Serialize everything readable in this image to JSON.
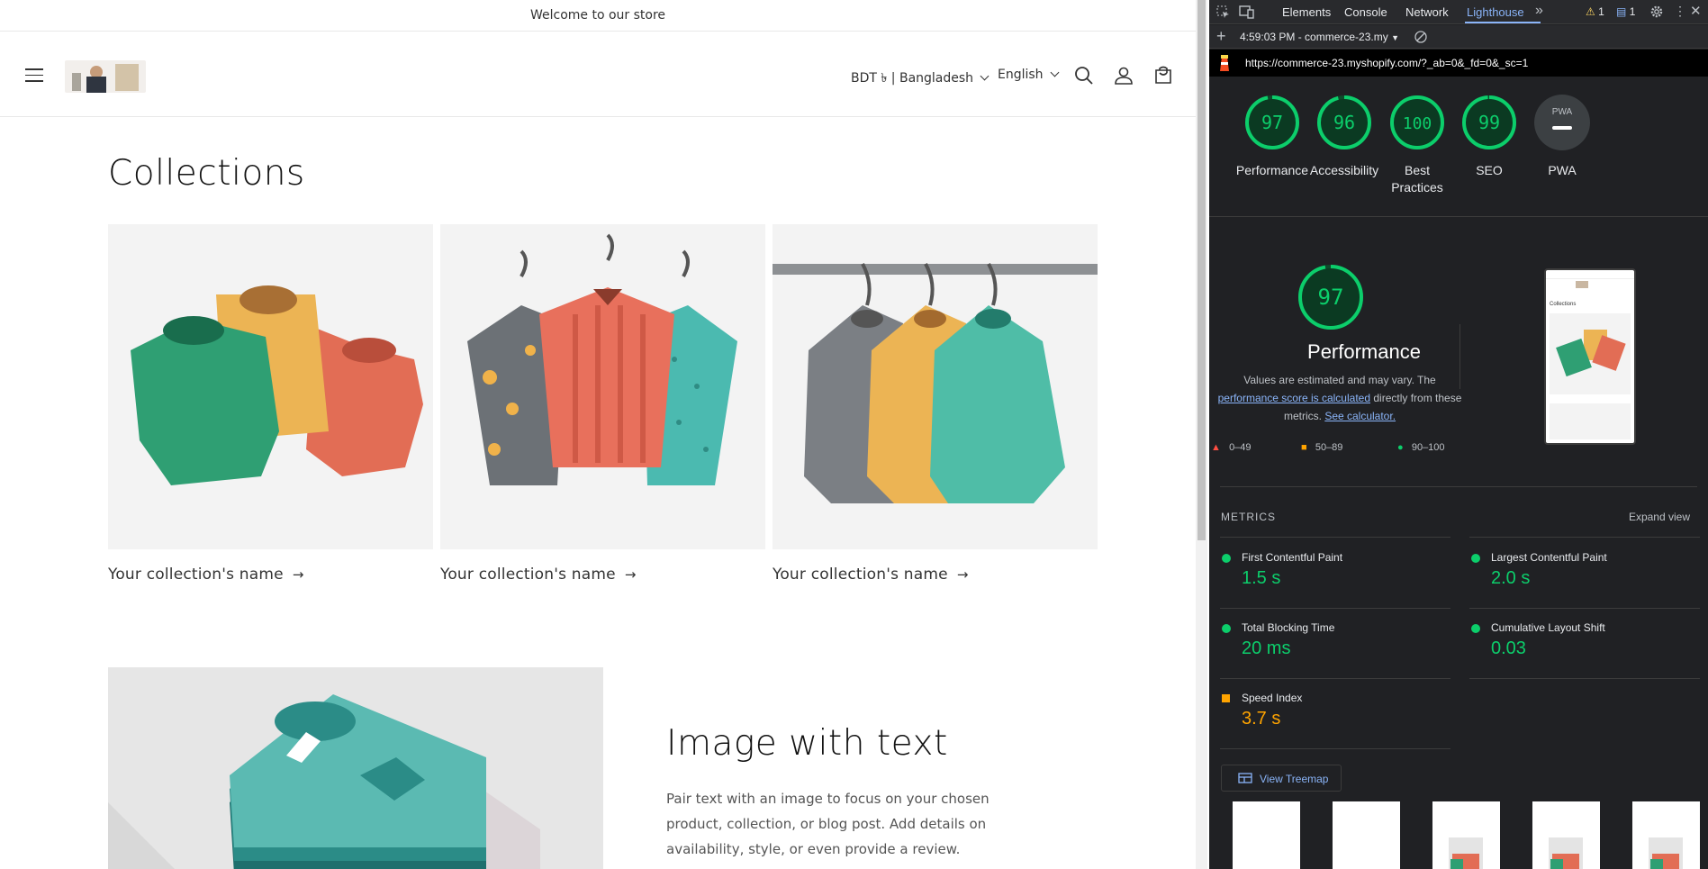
{
  "store": {
    "announcement": "Welcome to our store",
    "currency_selector": "BDT ৳ | Bangladesh",
    "language_selector": "English",
    "collections_title": "Collections",
    "collection_cards": [
      {
        "label": "Your collection's name"
      },
      {
        "label": "Your collection's name"
      },
      {
        "label": "Your collection's name"
      }
    ],
    "arrow": "→",
    "image_with_text": {
      "title": "Image with text",
      "body": "Pair text with an image to focus on your chosen product, collection, or blog post. Add details on availability, style, or even provide a review."
    }
  },
  "devtools": {
    "tabs": [
      "Elements",
      "Console",
      "Network",
      "Lighthouse"
    ],
    "active_tab": "Lighthouse",
    "more_tabs_icon": "»",
    "warnings_count": "1",
    "messages_count": "1",
    "report_selector": "4:59:03 PM - commerce-23.my",
    "url": "https://commerce-23.myshopify.com/?_ab=0&_fd=0&_sc=1",
    "scores": [
      {
        "label": "Performance",
        "value": "97",
        "score": 97
      },
      {
        "label": "Accessibility",
        "value": "96",
        "score": 96
      },
      {
        "label": "Best Practices",
        "value": "100",
        "score": 100
      },
      {
        "label": "SEO",
        "value": "99",
        "score": 99
      },
      {
        "label": "PWA",
        "value": "PWA"
      }
    ],
    "performance": {
      "score": "97",
      "score_fraction": 0.97,
      "title": "Performance",
      "desc_1": "Values are estimated and may vary. The",
      "link_1": "performance score is calculated",
      "desc_2": "directly from these",
      "desc_3": "metrics.",
      "link_2": "See calculator.",
      "legend": [
        "0–49",
        "50–89",
        "90–100"
      ]
    },
    "metrics_heading": "METRICS",
    "expand_view": "Expand view",
    "metrics": [
      {
        "name": "First Contentful Paint",
        "value": "1.5 s",
        "status": "pass"
      },
      {
        "name": "Largest Contentful Paint",
        "value": "2.0 s",
        "status": "pass"
      },
      {
        "name": "Total Blocking Time",
        "value": "20 ms",
        "status": "pass"
      },
      {
        "name": "Cumulative Layout Shift",
        "value": "0.03",
        "status": "pass"
      },
      {
        "name": "Speed Index",
        "value": "3.7 s",
        "status": "average"
      }
    ],
    "view_treemap": "View Treemap",
    "preview": {
      "collections": "Collections"
    }
  },
  "colors": {
    "pass": "#0cce6b",
    "average": "#ffa400",
    "fail": "#ff4e42",
    "link": "#8ab4f8",
    "devtools_bg": "#202124"
  }
}
